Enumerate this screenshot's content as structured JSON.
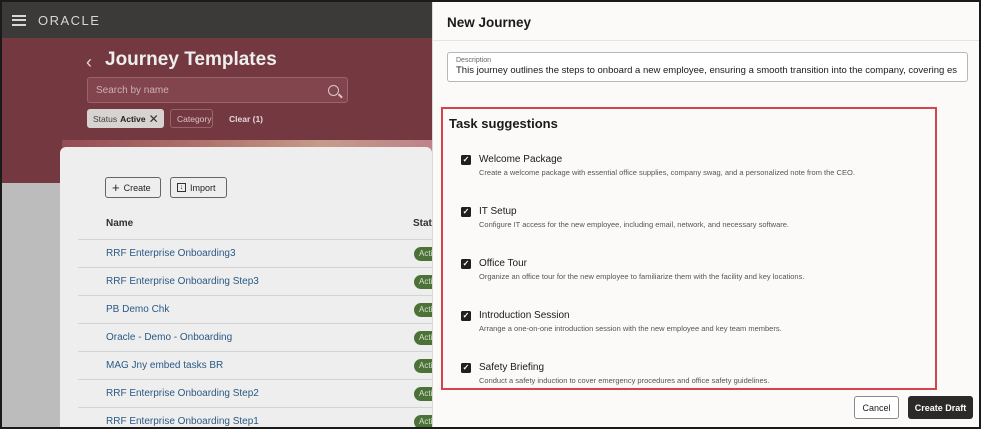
{
  "app": {
    "logo": "ORACLE",
    "page_title": "Journey Templates",
    "search_placeholder": "Search by name",
    "filters": {
      "status_label": "Status",
      "status_value": "Active",
      "category_label": "Category",
      "clear_label": "Clear (1)"
    },
    "buttons": {
      "create": "Create",
      "import": "Import"
    },
    "table": {
      "col_name": "Name",
      "col_status": "Statu",
      "rows": [
        {
          "name": "RRF Enterprise Onboarding3",
          "status": "Acti"
        },
        {
          "name": "RRF Enterprise Onboarding Step3",
          "status": "Acti"
        },
        {
          "name": "PB Demo Chk",
          "status": "Acti"
        },
        {
          "name": "Oracle - Demo - Onboarding",
          "status": "Acti"
        },
        {
          "name": "MAG Jny embed tasks BR",
          "status": "Acti"
        },
        {
          "name": "RRF Enterprise Onboarding Step2",
          "status": "Acti"
        },
        {
          "name": "RRF Enterprise Onboarding Step1",
          "status": "Acti"
        }
      ]
    }
  },
  "drawer": {
    "title": "New Journey",
    "description_label": "Description",
    "description_value": "This journey outlines the steps to onboard a new employee, ensuring a smooth transition into the company, covering es",
    "task_heading": "Task suggestions",
    "tasks": [
      {
        "title": "Welcome Package",
        "desc": "Create a welcome package with essential office supplies, company swag, and a personalized note from the CEO.",
        "checked": true
      },
      {
        "title": "IT Setup",
        "desc": "Configure IT access for the new employee, including email, network, and necessary software.",
        "checked": true
      },
      {
        "title": "Office Tour",
        "desc": "Organize an office tour for the new employee to familiarize them with the facility and key locations.",
        "checked": true
      },
      {
        "title": "Introduction Session",
        "desc": "Arrange a one-on-one introduction session with the new employee and key team members.",
        "checked": true
      },
      {
        "title": "Safety Briefing",
        "desc": "Conduct a safety induction to cover emergency procedures and office safety guidelines.",
        "checked": true
      }
    ],
    "cancel_label": "Cancel",
    "create_draft_label": "Create Draft"
  },
  "colors": {
    "banner": "#7b3a44",
    "highlight_border": "#d2454f",
    "primary_button": "#2c2a28",
    "status_badge": "#4f7a3a",
    "link": "#2b5e8f"
  }
}
